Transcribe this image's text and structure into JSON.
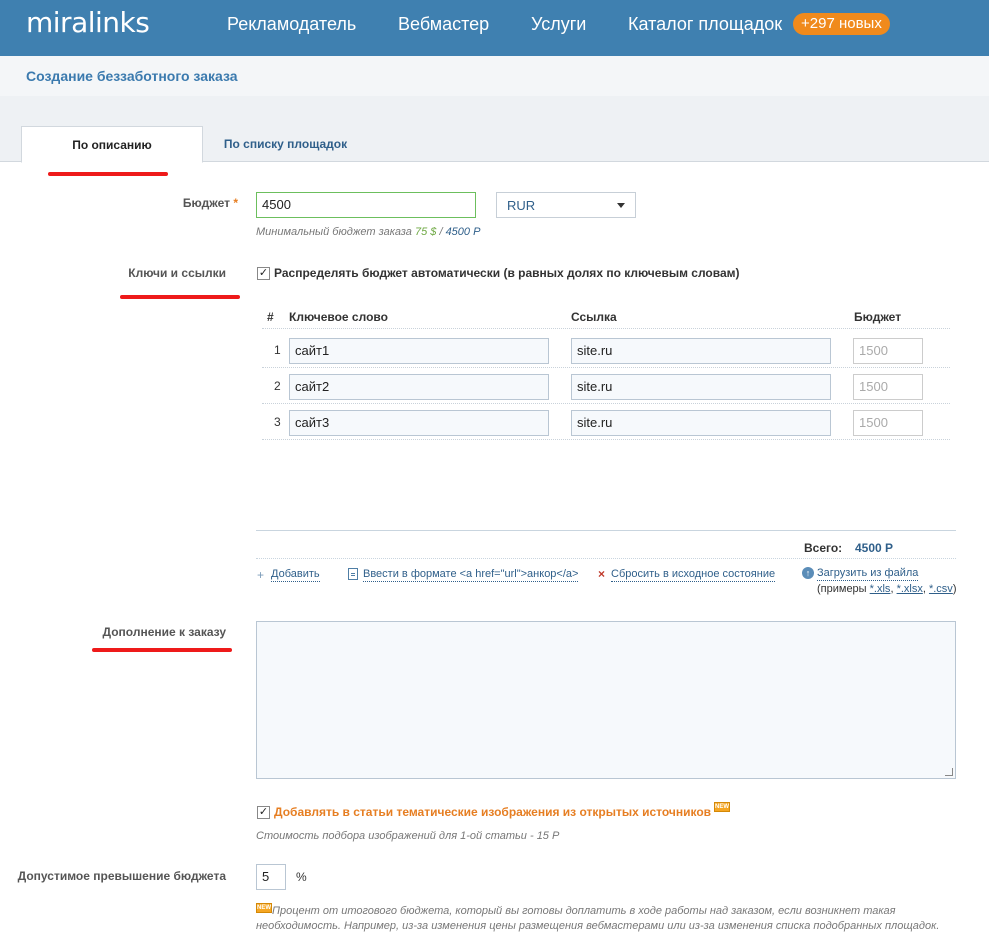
{
  "nav": {
    "logo": "miralinks",
    "items": [
      "Рекламодатель",
      "Вебмастер",
      "Услуги",
      "Каталог площадок"
    ],
    "badge": "+297 новых"
  },
  "header": {
    "title": "Создание беззаботного заказа"
  },
  "tabs": [
    {
      "label": "По описанию",
      "active": true
    },
    {
      "label": "По списку площадок",
      "active": false
    }
  ],
  "budget": {
    "label": "Бюджет",
    "required_mark": "*",
    "value": "4500",
    "currency": "RUR",
    "hint_prefix": "Минимальный бюджет заказа",
    "hint_usd": "75 $",
    "hint_sep": " / ",
    "hint_rub": "4500 Р"
  },
  "keys": {
    "label": "Ключи и ссылки",
    "auto_distribute_label": "Распределять бюджет автоматически (в равных долях по ключевым словам)",
    "auto_distribute_checked": true,
    "columns": [
      "#",
      "Ключевое слово",
      "Ссылка",
      "Бюджет"
    ],
    "rows": [
      {
        "num": "1",
        "keyword": "сайт1",
        "url": "site.ru",
        "budget": "1500"
      },
      {
        "num": "2",
        "keyword": "сайт2",
        "url": "site.ru",
        "budget": "1500"
      },
      {
        "num": "3",
        "keyword": "сайт3",
        "url": "site.ru",
        "budget": "1500"
      }
    ],
    "total_label": "Всего:",
    "total_value": "4500 Р",
    "actions": {
      "add": "Добавить",
      "enter_format": "Ввести в формате <a href=\"url\">анкор</a>",
      "reset": "Сбросить в исходное состояние",
      "upload": "Загрузить из файла",
      "examples_prefix": "(примеры",
      "ext_xls": "*.xls",
      "ext_xlsx": "*.xlsx",
      "ext_csv": "*.csv",
      "examples_suffix": ")"
    }
  },
  "addition": {
    "label": "Дополнение к заказу",
    "value": ""
  },
  "images": {
    "label": "Добавлять в статьи тематические изображения из открытых источников",
    "checked": true,
    "new_badge": "NEW",
    "hint": "Стоимость подбора изображений для 1-ой статьи - 15 Р"
  },
  "overrun": {
    "label": "Допустимое превышение бюджета",
    "value": "5",
    "unit": "%",
    "new_badge": "NEW",
    "hint_line1": "Процент от итогового бюджета, который вы готовы доплатить в ходе работы над заказом, если возникнет такая",
    "hint_line2": "необходимость. Например, из-за изменения цены размещения вебмастерами или из-за изменения списка подобранных площадок."
  },
  "colors": {
    "nav_bg": "#3f80b0",
    "accent": "#e67e22",
    "link": "#2f5f8a",
    "marker": "#ee1a1a"
  }
}
